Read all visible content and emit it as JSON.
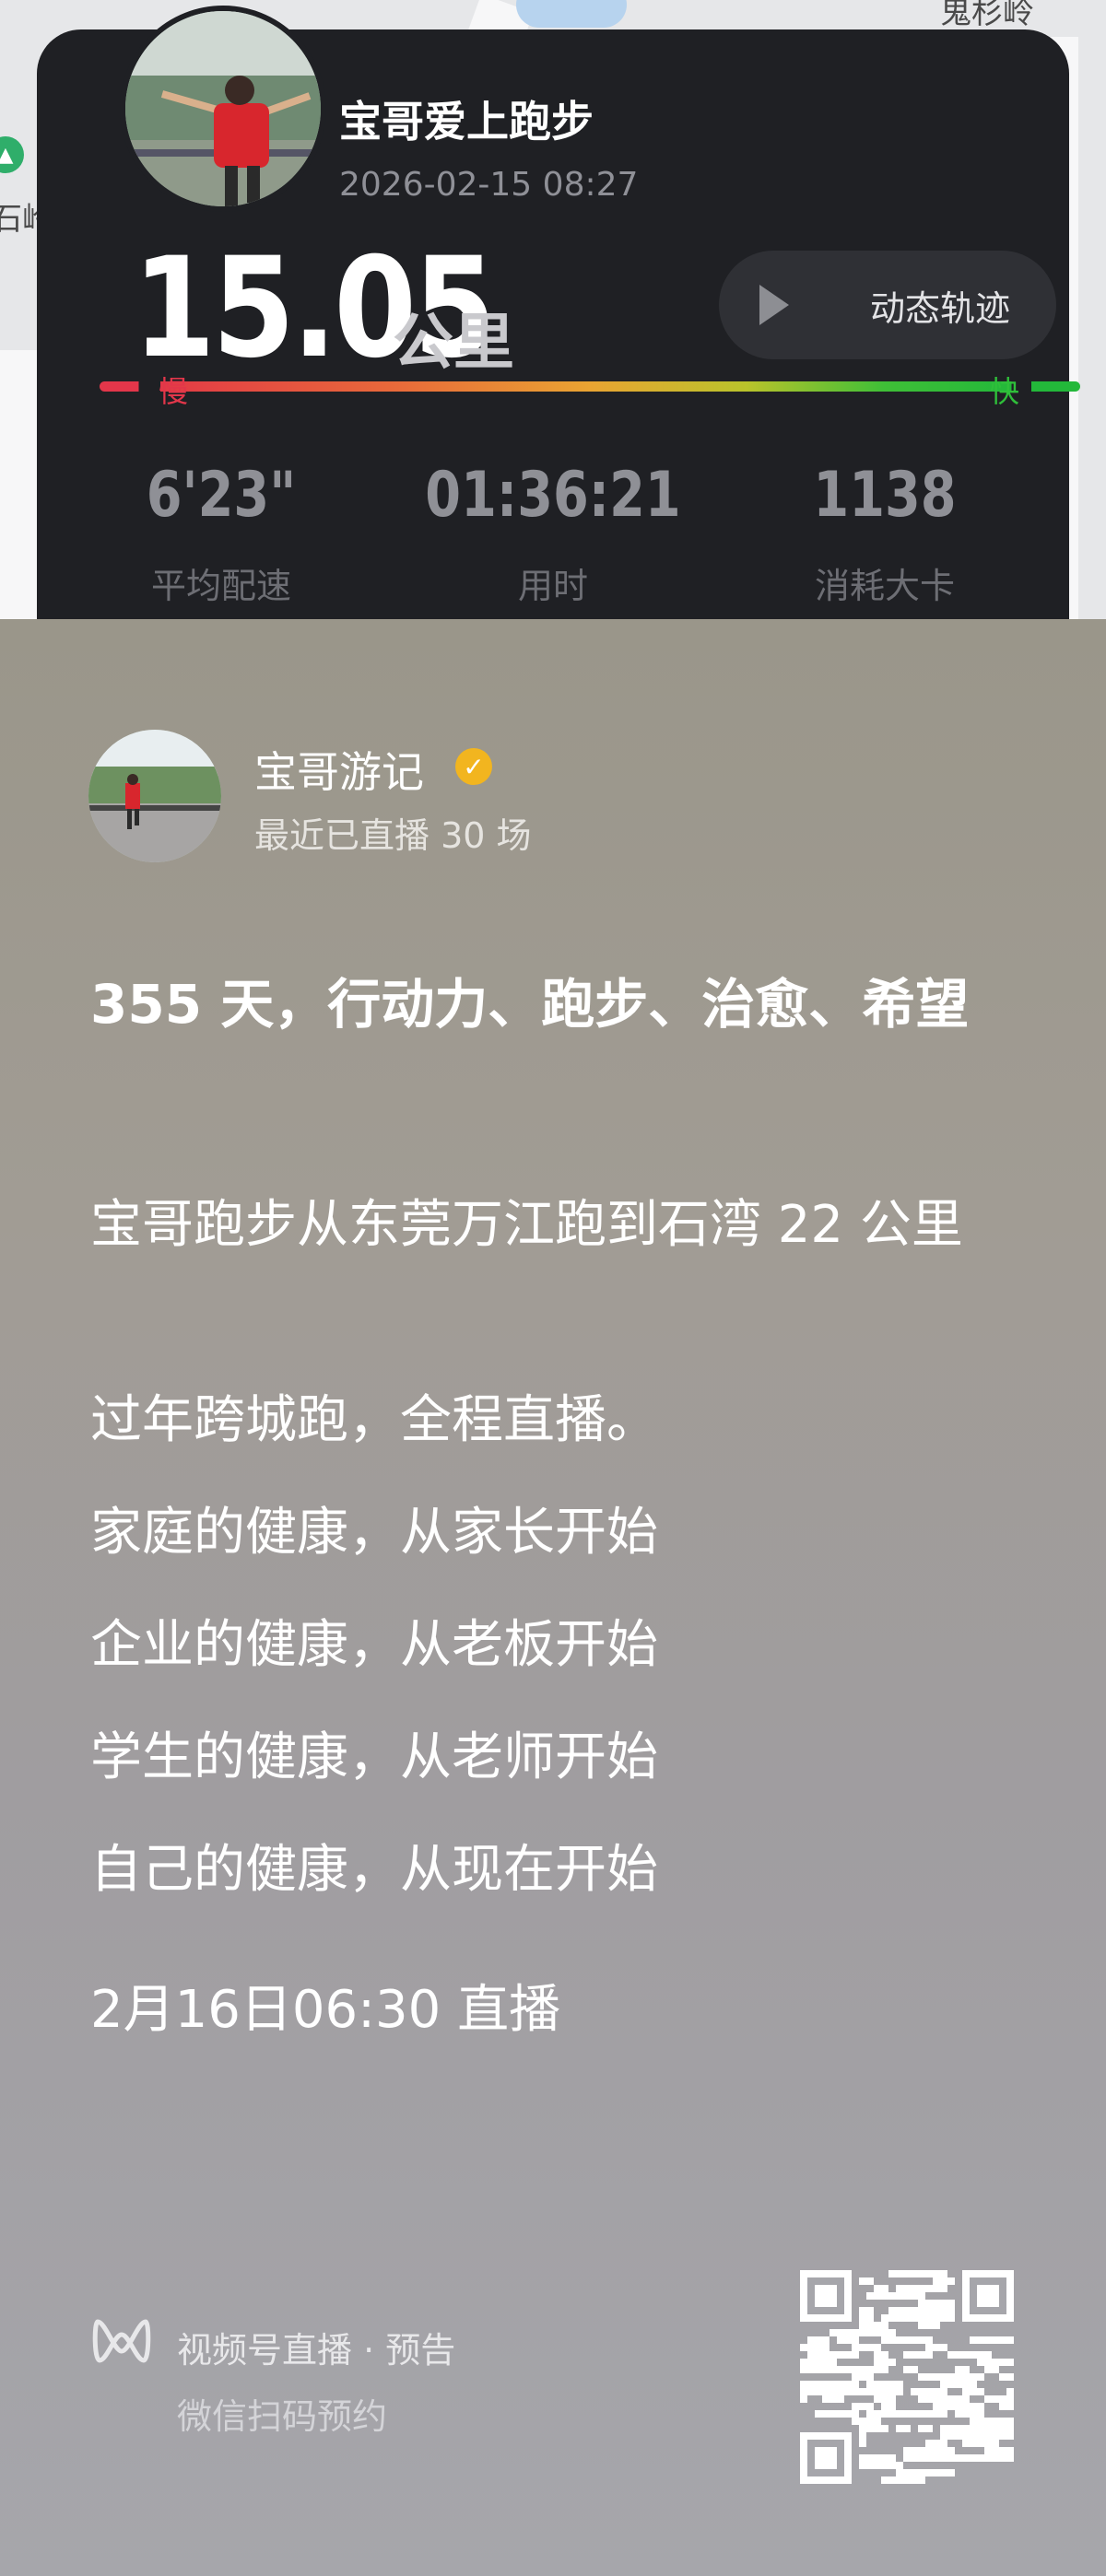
{
  "map": {
    "labels": [
      "鬼杉岭",
      "石岭"
    ],
    "pin_icon": "map-marker-icon"
  },
  "run_card": {
    "user_name": "宝哥爱上跑步",
    "datetime": "2026-02-15 08:27",
    "distance": "15.05",
    "distance_unit": "公里",
    "track_button_label": "动态轨迹",
    "pace_slow_label": "慢",
    "pace_fast_label": "快",
    "stats": [
      {
        "value": "6'23\"",
        "label": "平均配速"
      },
      {
        "value": "01:36:21",
        "label": "用时"
      },
      {
        "value": "1138",
        "label": "消耗大卡"
      }
    ],
    "colors": {
      "card_bg": "#1f2024",
      "slow": "#e3364a",
      "fast": "#2fbf3a"
    }
  },
  "host": {
    "name": "宝哥游记",
    "verified_icon": "verified-badge-icon",
    "subtitle": "最近已直播 30 场"
  },
  "post": {
    "headline": "355 天，行动力、跑步、治愈、希望",
    "lines": [
      "宝哥跑步从东莞万江跑到石湾 22 公里",
      "过年跨城跑，全程直播。",
      "家庭的健康，从家长开始",
      "企业的健康，从老板开始",
      "学生的健康，从老师开始",
      "自己的健康，从现在开始",
      "2月16日06:30 直播"
    ]
  },
  "footer": {
    "title": "视频号直播 · 预告",
    "subtitle": "微信扫码预约",
    "logo_icon": "channels-logo-icon",
    "qr_icon": "qr-code-icon"
  }
}
